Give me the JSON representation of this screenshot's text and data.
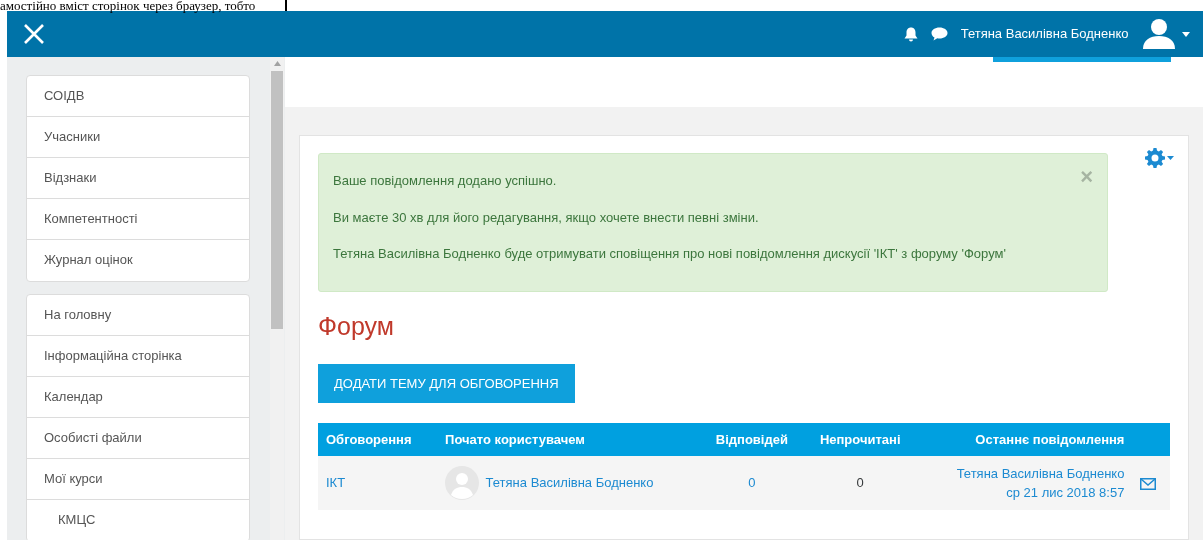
{
  "document_text": "амостійно вміст сторінок через браузер, тобто",
  "navbar": {
    "user_name": "Тетяна Василівна Бодненко"
  },
  "sidebar": {
    "groups": [
      {
        "items": [
          {
            "label": "СОІДВ"
          },
          {
            "label": "Учасники"
          },
          {
            "label": "Відзнаки"
          },
          {
            "label": "Компетентності"
          },
          {
            "label": "Журнал оцінок"
          }
        ]
      },
      {
        "items": [
          {
            "label": "На головну"
          },
          {
            "label": "Інформаційна сторінка"
          },
          {
            "label": "Календар"
          },
          {
            "label": "Особисті файли"
          },
          {
            "label": "Мої курси",
            "children": [
              {
                "label": "КМЦС"
              }
            ]
          }
        ]
      }
    ]
  },
  "alert": {
    "close": "×",
    "messages": [
      "Ваше повідомлення додано успішно.",
      "Ви маєте 30 хв для його редагування, якщо хочете внести певні зміни.",
      "Тетяна Василівна Бодненко буде отримувати сповіщення про нові повідомлення дискусії 'ІКТ' з форуму 'Форум'"
    ]
  },
  "heading": "Форум",
  "add_button": "ДОДАТИ ТЕМУ ДЛЯ ОБГОВОРЕННЯ",
  "table": {
    "columns": [
      "Обговорення",
      "Почато користувачем",
      "Відповідей",
      "Непрочитані",
      "Останнє повідомлення"
    ],
    "rows": [
      {
        "discussion": "ІКТ",
        "started_by": "Тетяна Василівна Бодненко",
        "replies": "0",
        "unread": "0",
        "last_post_author": "Тетяна Василівна Бодненко",
        "last_post_date": "ср 21 лис 2018 8:57"
      }
    ]
  }
}
